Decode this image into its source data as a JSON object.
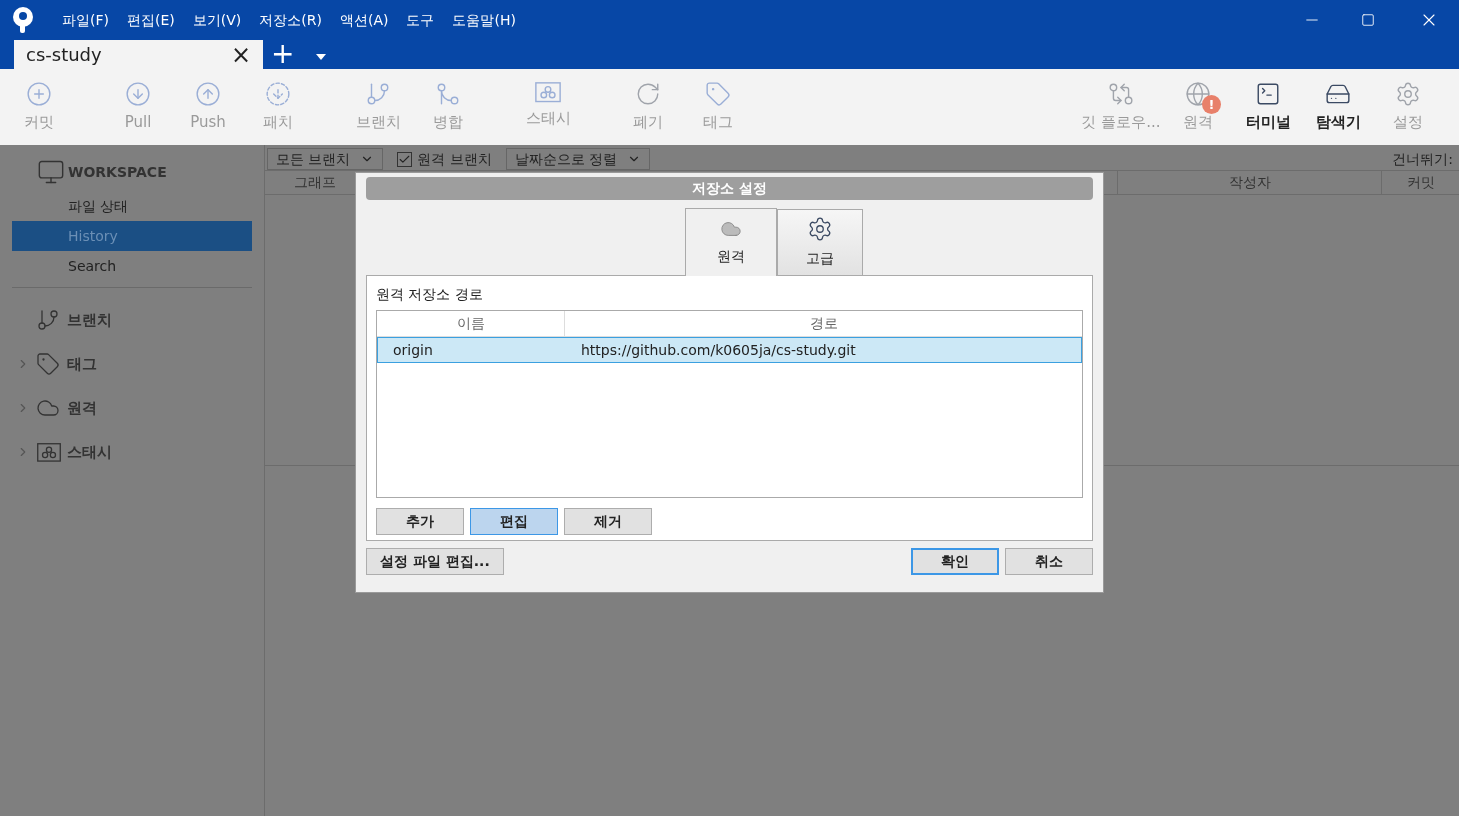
{
  "menu": [
    "파일(F)",
    "편집(E)",
    "보기(V)",
    "저장소(R)",
    "액션(A)",
    "도구",
    "도움말(H)"
  ],
  "repo_tabs": [
    {
      "label": "cs-study",
      "selected": true,
      "close": "×"
    }
  ],
  "new_tab": "+",
  "toolbar_left": [
    {
      "kind": "commit",
      "label": "커밋",
      "disabled": true
    },
    {
      "kind": "pull",
      "label": "Pull",
      "disabled": true
    },
    {
      "kind": "push",
      "label": "Push",
      "disabled": true
    },
    {
      "kind": "patch",
      "label": "패치",
      "disabled": true
    },
    {
      "kind": "branch",
      "label": "브랜치",
      "disabled": true
    },
    {
      "kind": "merge",
      "label": "병합",
      "disabled": true
    },
    {
      "kind": "stash",
      "label": "스태시",
      "disabled": true
    },
    {
      "kind": "discard",
      "label": "폐기",
      "disabled": true
    },
    {
      "kind": "tag",
      "label": "태그",
      "disabled": true
    }
  ],
  "toolbar_right": [
    {
      "kind": "flow",
      "label": "깃 플로우...",
      "disabled": true
    },
    {
      "kind": "remote",
      "label": "원격",
      "disabled": true,
      "badge": "!"
    },
    {
      "kind": "terminal",
      "label": "터미널",
      "disabled": false
    },
    {
      "kind": "explorer",
      "label": "탐색기",
      "disabled": false
    },
    {
      "kind": "settings",
      "label": "설정",
      "disabled": true
    }
  ],
  "sidebar": {
    "workspace": "WORKSPACE",
    "items": [
      {
        "label": "파일 상태",
        "selected": false
      },
      {
        "label": "History",
        "selected": true
      },
      {
        "label": "Search",
        "selected": false
      }
    ],
    "sections": [
      {
        "kind": "branch",
        "label": "브랜치",
        "expandable": false
      },
      {
        "kind": "tag",
        "label": "태그",
        "expandable": true
      },
      {
        "kind": "remote",
        "label": "원격",
        "expandable": true
      },
      {
        "kind": "stash",
        "label": "스태시",
        "expandable": true
      }
    ]
  },
  "filter_bar": {
    "branches": "모든 브랜치",
    "remote_branches": {
      "label": "원격 브랜치",
      "checked": true
    },
    "sort": "날짜순으로 정렬",
    "skip": "건너뛰기:"
  },
  "history_columns": [
    "그래프",
    "작성자",
    "커밋"
  ],
  "dialog": {
    "title": "저장소 설정",
    "tabs": [
      {
        "kind": "remote",
        "label": "원격",
        "selected": true
      },
      {
        "kind": "advanced",
        "label": "고급",
        "selected": false
      }
    ],
    "group_label": "원격 저장소 경로",
    "columns": [
      "이름",
      "경로"
    ],
    "rows": [
      {
        "name": "origin",
        "path": "https://github.com/k0605ja/cs-study.git",
        "selected": true
      }
    ],
    "row_buttons": [
      {
        "label": "추가",
        "selected": false
      },
      {
        "label": "편집",
        "selected": true
      },
      {
        "label": "제거",
        "selected": false
      }
    ],
    "edit_config": "설정 파일 편집...",
    "ok": {
      "label": "확인",
      "default": true
    },
    "cancel": {
      "label": "취소",
      "default": false
    }
  }
}
